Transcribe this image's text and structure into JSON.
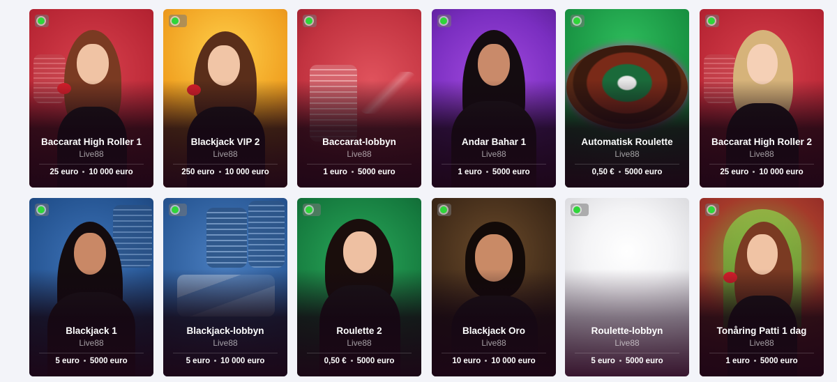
{
  "cards": [
    {
      "name": "Baccarat High Roller 1",
      "provider": "Live88",
      "min": "25 euro",
      "max": "10 000 euro"
    },
    {
      "name": "Blackjack VIP 2",
      "provider": "Live88",
      "min": "250 euro",
      "max": "10 000 euro"
    },
    {
      "name": "Baccarat-lobbyn",
      "provider": "Live88",
      "min": "1 euro",
      "max": "5000 euro"
    },
    {
      "name": "Andar Bahar 1",
      "provider": "Live88",
      "min": "1 euro",
      "max": "5000 euro"
    },
    {
      "name": "Automatisk Roulette",
      "provider": "Live88",
      "min": "0,50 €",
      "max": "5000 euro"
    },
    {
      "name": "Baccarat High Roller 2",
      "provider": "Live88",
      "min": "25 euro",
      "max": "10 000 euro"
    },
    {
      "name": "Blackjack 1",
      "provider": "Live88",
      "min": "5 euro",
      "max": "5000 euro"
    },
    {
      "name": "Blackjack-lobbyn",
      "provider": "Live88",
      "min": "5 euro",
      "max": "10 000 euro"
    },
    {
      "name": "Roulette 2",
      "provider": "Live88",
      "min": "0,50 €",
      "max": "5000 euro"
    },
    {
      "name": "Blackjack Oro",
      "provider": "Live88",
      "min": "10 euro",
      "max": "10 000 euro"
    },
    {
      "name": "Roulette-lobbyn",
      "provider": "Live88",
      "min": "5 euro",
      "max": "5000 euro"
    },
    {
      "name": "Tonåring Patti 1 dag",
      "provider": "Live88",
      "min": "1 euro",
      "max": "5000 euro"
    }
  ],
  "colors": {
    "live_indicator": "#2fd53a",
    "page_background": "#f3f4f9"
  }
}
